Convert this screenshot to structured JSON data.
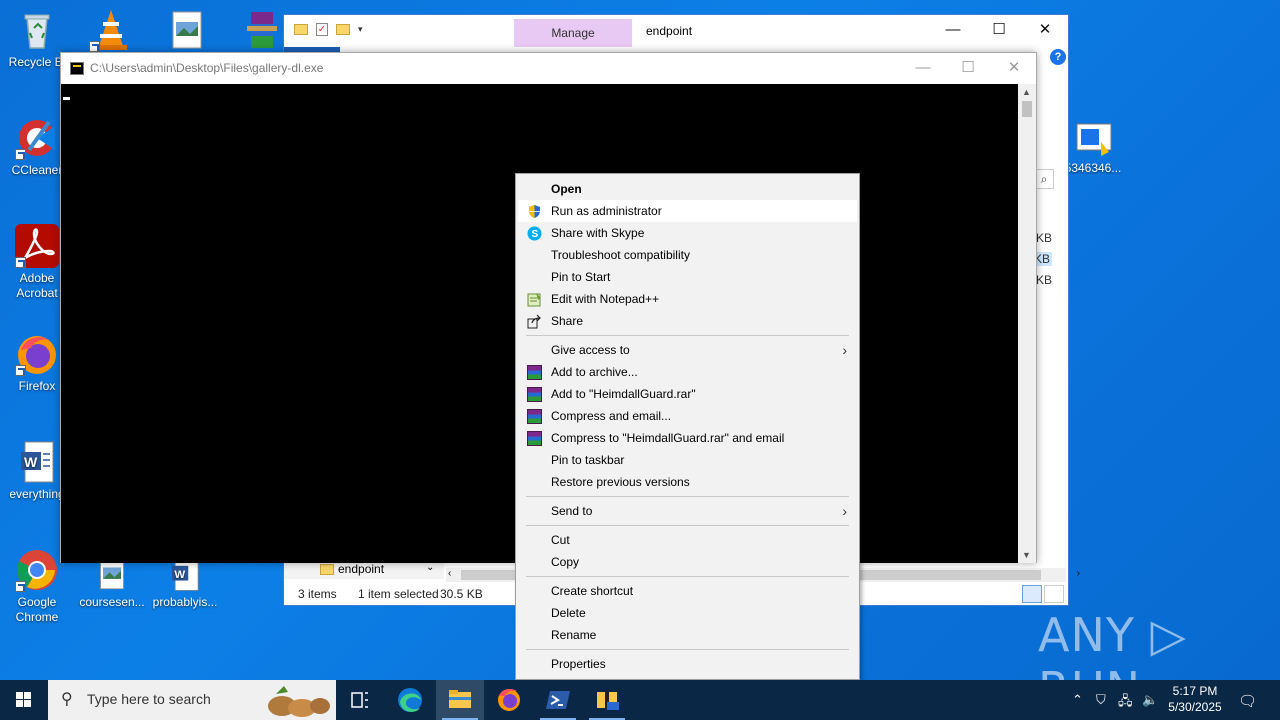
{
  "desktop": {
    "icons": [
      {
        "label": "Recycle Bi"
      },
      {
        "label": "CCleaner"
      },
      {
        "label": "Adobe Acrobat"
      },
      {
        "label": "Firefox"
      },
      {
        "label": "everything"
      },
      {
        "label": "Google Chrome"
      },
      {
        "label": "coursesen..."
      },
      {
        "label": "probablyis..."
      },
      {
        "label": "5346346..."
      }
    ]
  },
  "explorer": {
    "manage_tab": "Manage",
    "title": "endpoint",
    "minimize": "—",
    "maximize": "☐",
    "close": "✕",
    "help": "?",
    "sizes": [
      "KB",
      "KB",
      "KB"
    ],
    "nav_folder": "endpoint",
    "status": {
      "items": "3 items",
      "selected": "1 item selected",
      "size": "30.5 KB"
    }
  },
  "console": {
    "title": "C:\\Users\\admin\\Desktop\\Files\\gallery-dl.exe",
    "minimize": "—",
    "maximize": "☐",
    "close": "✕"
  },
  "context_menu": {
    "items": [
      {
        "label": "Open"
      },
      {
        "label": "Run as administrator"
      },
      {
        "label": "Share with Skype"
      },
      {
        "label": "Troubleshoot compatibility"
      },
      {
        "label": "Pin to Start"
      },
      {
        "label": "Edit with Notepad++"
      },
      {
        "label": "Share"
      },
      {
        "label": "Give access to"
      },
      {
        "label": "Add to archive..."
      },
      {
        "label": "Add to \"HeimdallGuard.rar\""
      },
      {
        "label": "Compress and email..."
      },
      {
        "label": "Compress to \"HeimdallGuard.rar\" and email"
      },
      {
        "label": "Pin to taskbar"
      },
      {
        "label": "Restore previous versions"
      },
      {
        "label": "Send to"
      },
      {
        "label": "Cut"
      },
      {
        "label": "Copy"
      },
      {
        "label": "Create shortcut"
      },
      {
        "label": "Delete"
      },
      {
        "label": "Rename"
      },
      {
        "label": "Properties"
      }
    ]
  },
  "taskbar": {
    "search_placeholder": "Type here to search",
    "time": "5:17 PM",
    "date": "5/30/2025"
  },
  "watermark": "ANY ▷ RUN",
  "colors": {
    "desktop": "#0a72da",
    "taskbar": "#0b2746",
    "manage_tab": "#e8c9f3",
    "menu_bg": "#f2f2f2"
  }
}
